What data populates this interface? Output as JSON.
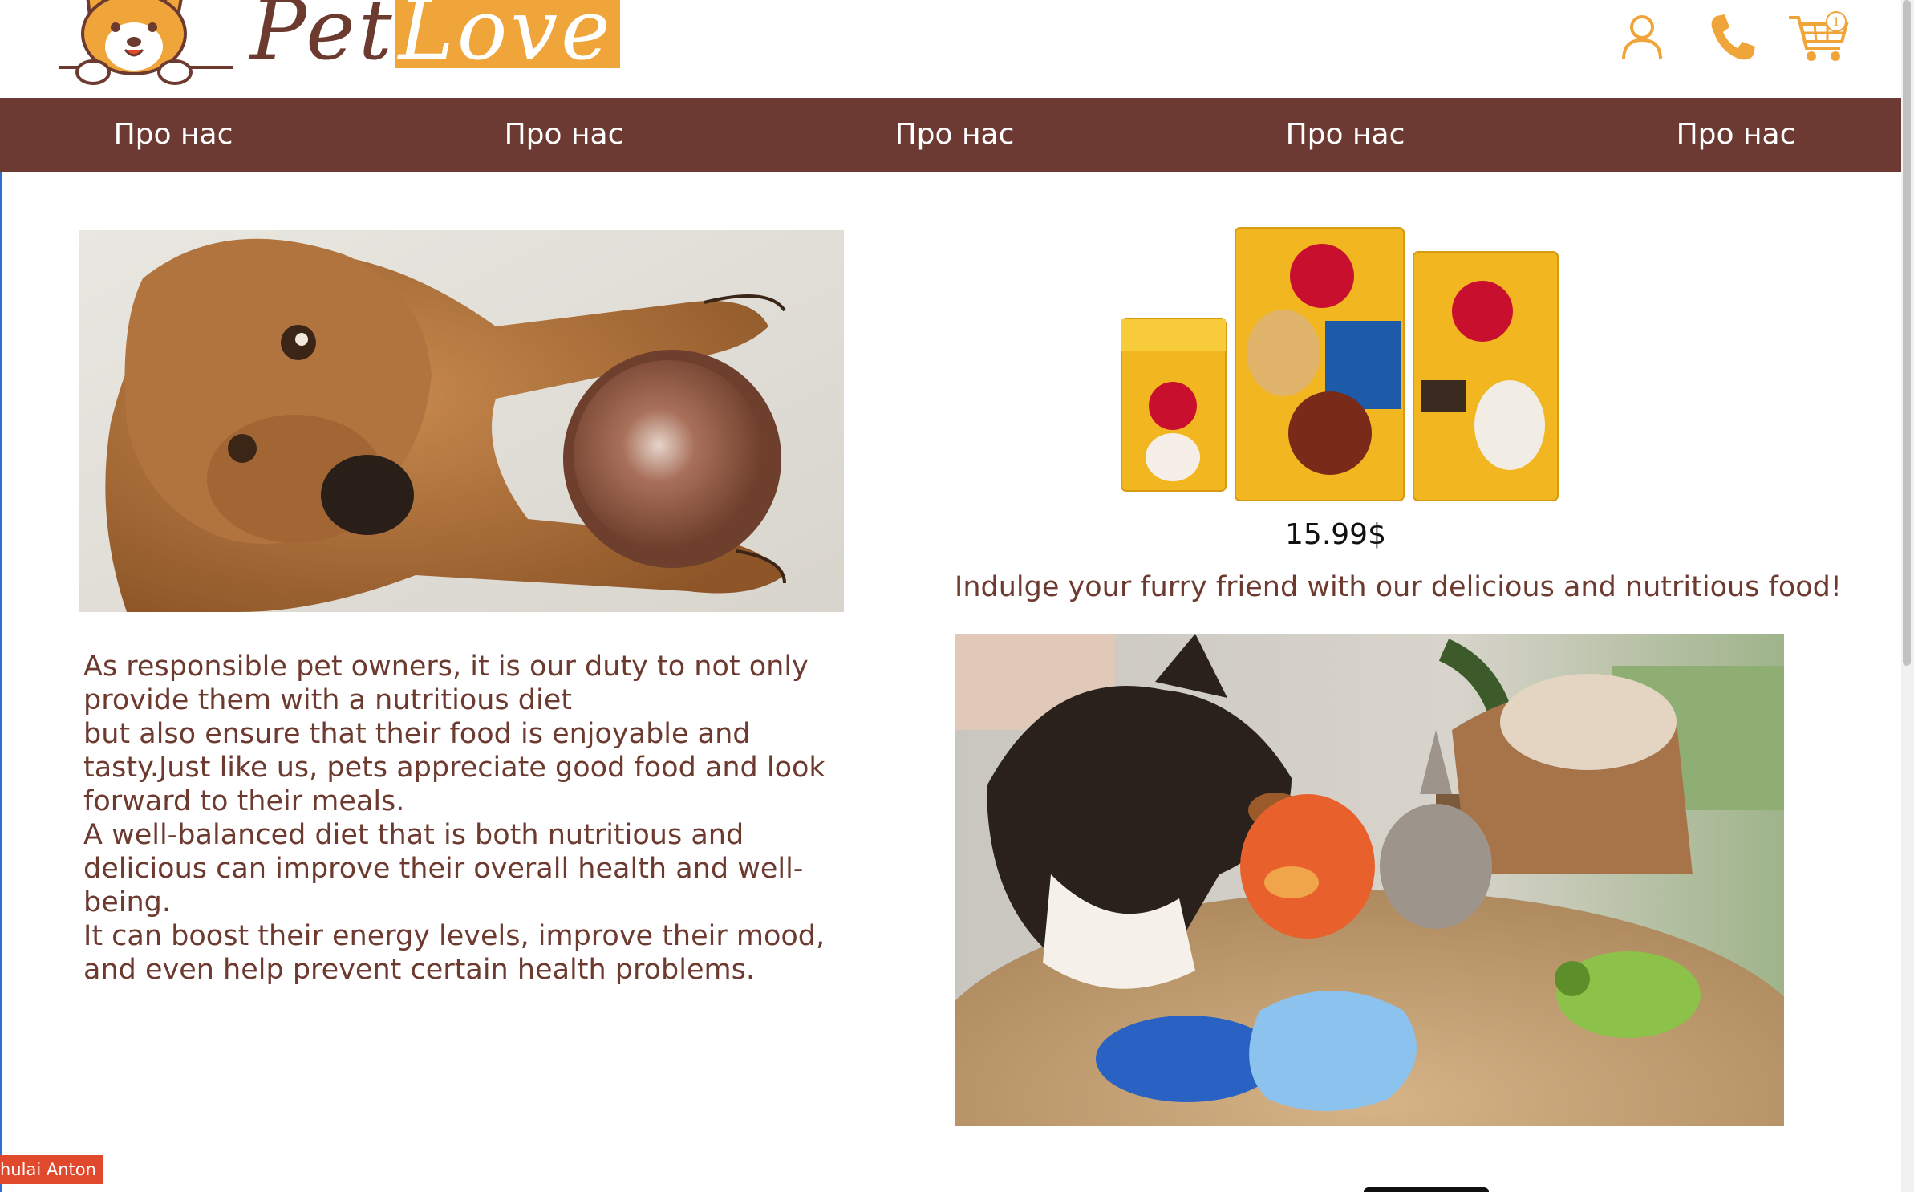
{
  "brand": {
    "part1": "Pet",
    "part2": "Love",
    "accent_color": "#f0a53a",
    "brand_color": "#6d3a30"
  },
  "header_icons": {
    "user": "user-icon",
    "phone": "phone-icon",
    "cart": "cart-icon",
    "cart_count": "1"
  },
  "nav": {
    "background": "#6d3a33",
    "items": [
      {
        "label": "Про нас"
      },
      {
        "label": "Про нас"
      },
      {
        "label": "Про нас"
      },
      {
        "label": "Про нас"
      },
      {
        "label": "Про нас"
      }
    ]
  },
  "product": {
    "price": "15.99$",
    "tagline": "Indulge your furry friend with our delicious and nutritious food!"
  },
  "article": {
    "lines": [
      "As responsible pet owners, it is our duty to not only provide them with a nutritious diet",
      "but also ensure that their food is enjoyable and tasty.Just like us, pets appreciate good food and look forward to their meals.",
      "A well-balanced diet that is both nutritious and delicious can improve their overall health and well-being.",
      "It can boost their energy levels, improve their mood, and even help prevent certain health problems."
    ]
  },
  "credit": "hulai Anton"
}
